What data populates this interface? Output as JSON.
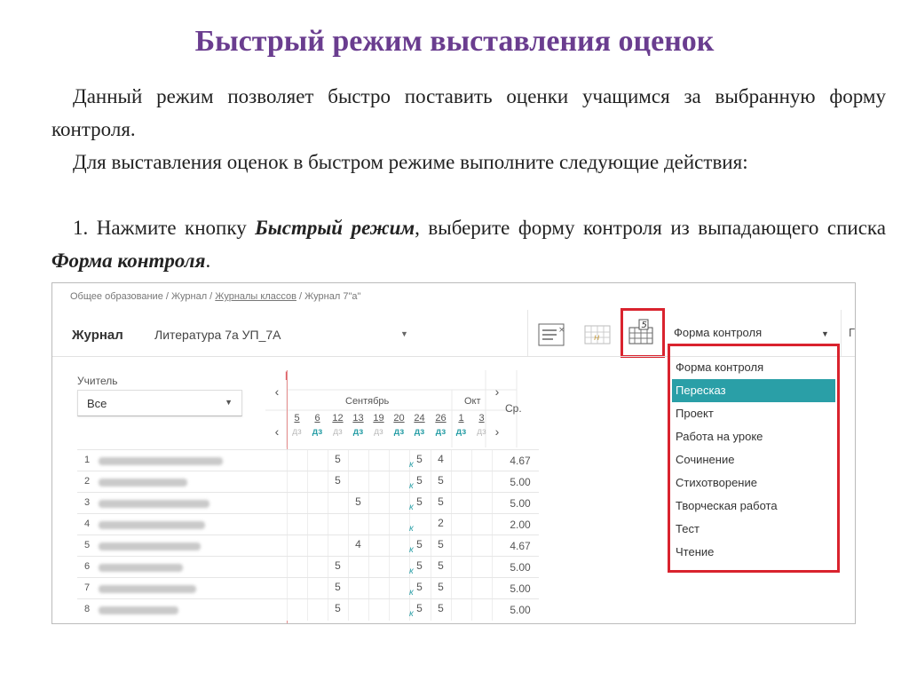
{
  "slide": {
    "title": "Быстрый режим выставления оценок",
    "para1": "Данный режим позволяет быстро поставить оценки учащимся за выбранную форму контроля.",
    "para2": "Для выставления оценок в быстром режиме выполните следующие действия:",
    "para3_prefix": "1. Нажмите кнопку ",
    "para3_bold1": "Быстрый режим",
    "para3_mid": ", выберите форму контроля из выпадающего списка ",
    "para3_bold2": "Форма контроля",
    "para3_end": "."
  },
  "journal": {
    "breadcrumb_start": "Общее образование / Журнал / ",
    "breadcrumb_link": "Журналы классов",
    "breadcrumb_end": " / Журнал 7\"а\"",
    "header_title": "Журнал",
    "subject": "Литература 7а УП_7А",
    "form_control_label": "Форма контроля",
    "extra_label": "Г",
    "quick_mode_icon_digit": "5",
    "teacher_label": "Учитель",
    "teacher_value": "Все",
    "months": [
      "Сентябрь",
      "Окт"
    ],
    "avg_header": "Ср.",
    "dates": [
      {
        "day": "5",
        "type": "дз",
        "active": false
      },
      {
        "day": "6",
        "type": "дз",
        "active": true
      },
      {
        "day": "12",
        "type": "дз",
        "active": false
      },
      {
        "day": "13",
        "type": "дз",
        "active": true
      },
      {
        "day": "19",
        "type": "дз",
        "active": false
      },
      {
        "day": "20",
        "type": "дз",
        "active": true
      },
      {
        "day": "24",
        "type": "дз",
        "active": true
      },
      {
        "day": "26",
        "type": "дз",
        "active": true
      },
      {
        "day": "1",
        "type": "дз",
        "active": true
      },
      {
        "day": "3",
        "type": "дз",
        "active": false
      }
    ],
    "k_mark": "к",
    "rows": [
      {
        "n": "1",
        "g12": "5",
        "g13": "",
        "g24": "5",
        "g26": "4",
        "avg": "4.67"
      },
      {
        "n": "2",
        "g12": "5",
        "g13": "",
        "g24": "5",
        "g26": "5",
        "avg": "5.00"
      },
      {
        "n": "3",
        "g12": "",
        "g13": "5",
        "g24": "5",
        "g26": "5",
        "avg": "5.00"
      },
      {
        "n": "4",
        "g12": "",
        "g13": "",
        "g24": "",
        "g26": "2",
        "avg": "2.00"
      },
      {
        "n": "5",
        "g12": "",
        "g13": "4",
        "g24": "5",
        "g26": "5",
        "avg": "4.67"
      },
      {
        "n": "6",
        "g12": "5",
        "g13": "",
        "g24": "5",
        "g26": "5",
        "avg": "5.00"
      },
      {
        "n": "7",
        "g12": "5",
        "g13": "",
        "g24": "5",
        "g26": "5",
        "avg": "5.00"
      },
      {
        "n": "8",
        "g12": "5",
        "g13": "",
        "g24": "5",
        "g26": "5",
        "avg": "5.00"
      }
    ],
    "dropdown": {
      "selected_index": 1,
      "options": [
        "Форма контроля",
        "Пересказ",
        "Проект",
        "Работа на уроке",
        "Сочинение",
        "Стихотворение",
        "Творческая работа",
        "Тест",
        "Чтение"
      ]
    }
  },
  "colors": {
    "title": "#6a3d8f",
    "accent": "#2a9fa7",
    "highlight": "#d9232e"
  }
}
